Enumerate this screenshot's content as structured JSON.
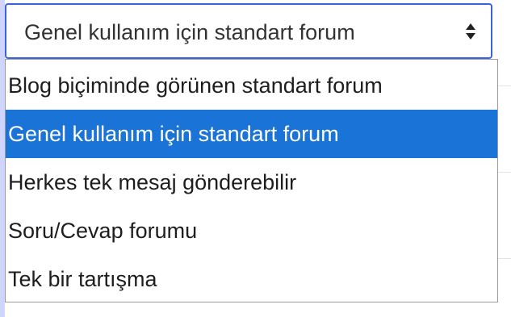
{
  "select": {
    "value": "Genel kullanım için standart forum",
    "caret_icon": "up-down-caret-icon"
  },
  "dropdown": {
    "options": [
      {
        "label": "Blog biçiminde görünen standart forum",
        "selected": false
      },
      {
        "label": "Genel kullanım için standart forum",
        "selected": true
      },
      {
        "label": "Herkes tek mesaj gönderebilir",
        "selected": false
      },
      {
        "label": "Soru/Cevap forumu",
        "selected": false
      },
      {
        "label": "Tek bir tartışma",
        "selected": false
      }
    ]
  },
  "colors": {
    "focus_border": "#3b63d9",
    "selected_background": "#1a73d6",
    "selected_text": "#ffffff",
    "option_text": "#1e1e1e"
  }
}
